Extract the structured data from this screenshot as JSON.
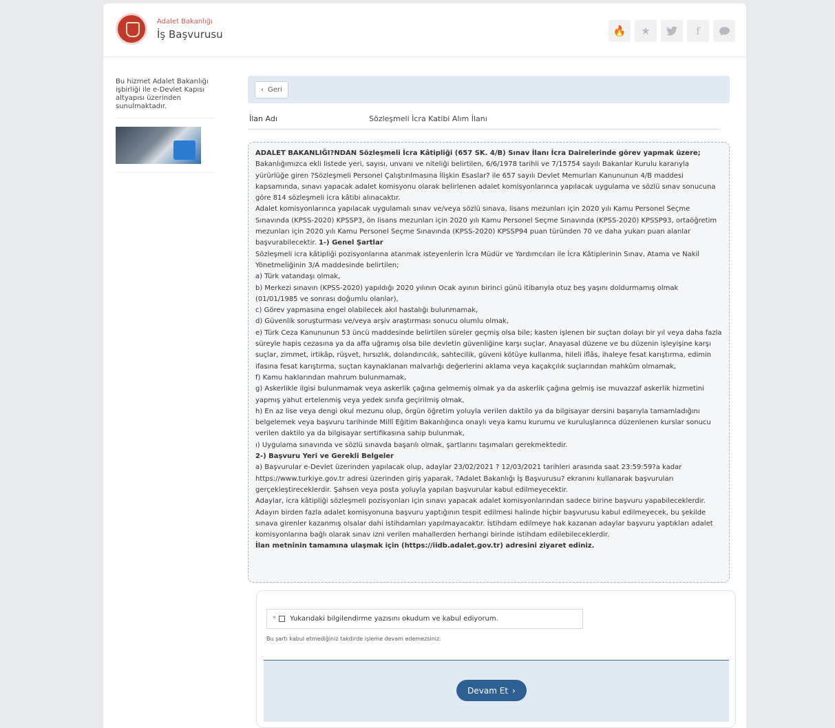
{
  "header": {
    "subtitle": "Adalet Bakanlığı",
    "title": "İş Başvurusu",
    "icons": [
      "fire-icon",
      "star-icon",
      "twitter-icon",
      "facebook-icon",
      "chat-icon"
    ]
  },
  "sidebar": {
    "info": "Bu hizmet Adalet Bakanlığı işbirliği ile e-Devlet Kapısı altyapısı üzerinden sunulmaktadır."
  },
  "nav": {
    "back_label": "Geri"
  },
  "ilan": {
    "label": "İlan Adı",
    "value": "Sözleşmeli İcra Katibi Alım İlanı"
  },
  "notice": {
    "heading": "ADALET BAKANLIĞI?NDAN Sözleşmeli İcra Kâtipliği (657 SK. 4/B) Sınav İlanı İcra Dairelerinde görev yapmak üzere;",
    "p1": "Bakanlığımızca ekli listede yeri, sayısı, unvanı ve niteliği belirtilen, 6/6/1978 tarihli ve 7/15754 sayılı Bakanlar Kurulu kararıyla yürürlüğe giren ?Sözleşmeli Personel Çalıştırılmasına İlişkin Esaslar? ile 657 sayılı Devlet Memurları Kanununun 4/B maddesi kapsamında, sınavı yapacak adalet komisyonu olarak belirlenen adalet komisyonlarınca yapılacak uygulama ve sözlü sınav sonucuna göre 814 sözleşmeli icra kâtibi alınacaktır.",
    "p2": "Adalet komisyonlarınca yapılacak uygulamalı sınav ve/veya sözlü sınava, lisans mezunları için 2020 yılı Kamu Personel Seçme Sınavında (KPSS-2020) KPSSP3, ön lisans mezunları için 2020 yılı Kamu Personel Seçme Sınavında (KPSS-2020) KPSSP93, ortaöğretim mezunları için 2020 yılı Kamu Personel Seçme Sınavında (KPSS-2020) KPSSP94 puan türünden 70 ve daha yukarı puan alanlar başvurabilecektir.",
    "genel_sartlar": "1-) Genel Şartlar",
    "p3": "Sözleşmeli icra kâtipliği pozisyonlarına atanmak isteyenlerin İcra Müdür ve Yardımcıları ile İcra Kâtiplerinin Sınav, Atama ve Nakil Yönetmeliğinin 3/A maddesinde belirtilen;",
    "a": "a) Türk vatandaşı olmak,",
    "b": "b) Merkezi sınavın (KPSS-2020) yapıldığı 2020 yılının Ocak ayının birinci günü itibarıyla otuz beş yaşını doldurmamış olmak (01/01/1985 ve sonrası doğumlu olanlar),",
    "c": "c) Görev yapmasına engel olabilecek akıl hastalığı bulunmamak,",
    "d": "d) Güvenlik soruşturması ve/veya arşiv araştırması sonucu olumlu olmak,",
    "e": "e) Türk Ceza Kanununun 53 üncü maddesinde belirtilen süreler geçmiş olsa bile; kasten işlenen bir suçtan dolayı bir yıl veya daha fazla süreyle hapis cezasına ya da affa uğramış olsa bile devletin güvenliğine karşı suçlar, Anayasal düzene ve bu düzenin işleyişine karşı suçlar, zimmet, irtikâp, rüşvet, hırsızlık, dolandırıcılık, sahtecilik, güveni kötüye kullanma, hileli iflâs, ihaleye fesat karıştırma, edimin ifasına fesat karıştırma, suçtan kaynaklanan malvarlığı değerlerini aklama veya kaçakçılık suçlarından mahkûm olmamak,",
    "f": "f) Kamu haklarından mahrum bulunmamak,",
    "g": "g) Askerlikle ilgisi bulunmamak veya askerlik çağına gelmemiş olmak ya da askerlik çağına gelmiş ise muvazzaf askerlik hizmetini yapmış yahut ertelenmiş veya yedek sınıfa geçirilmiş olmak,",
    "h": "h) En az lise veya dengi okul mezunu olup, örgün öğretim yoluyla verilen daktilo ya da bilgisayar dersini başarıyla tamamladığını belgelemek veya başvuru tarihinde Millî Eğitim Bakanlığınca onaylı veya kamu kurumu ve kuruluşlarınca düzenlenen kurslar sonucu verilen daktilo ya da bilgisayar sertifikasına sahip bulunmak,",
    "i": "ı) Uygulama sınavında ve sözlü sınavda başarılı olmak, şartlarını taşımaları gerekmektedir.",
    "basvuru_heading": "2-) Başvuru Yeri ve Gerekli Belgeler",
    "p4": "a) Başvurular e-Devlet üzerinden yapılacak olup, adaylar 23/02/2021 ? 12/03/2021 tarihleri arasında saat 23:59:59?a kadar https://www.turkiye.gov.tr adresi üzerinden giriş yaparak, ?Adalet Bakanlığı İş Başvurusu? ekranını kullanarak başvuruları gerçekleştireceklerdir. Şahsen veya posta yoluyla yapılan başvurular kabul edilmeyecektir.",
    "p5": "Adaylar, icra kâtipliği sözleşmeli pozisyonları için sınavı yapacak adalet komisyonlarından sadece birine başvuru yapabileceklerdir. Adayın birden fazla adalet komisyonuna başvuru yaptığının tespit edilmesi halinde hiçbir başvurusu kabul edilmeyecek, bu şekilde sınava girenler kazanmış olsalar dahi istihdamları yapılmayacaktır. İstihdam edilmeye hak kazanan adaylar başvuru yaptıkları adalet komisyonlarına bağlı olarak sınav izni verilen mahallerden herhangi birinde istihdam edilebileceklerdir.",
    "footer": "İlan metninin tamamına ulaşmak için (https://iidb.adalet.gov.tr) adresini ziyaret ediniz."
  },
  "agreement": {
    "required_mark": "*",
    "checkbox_label": "Yukarıdaki bilgilendirme yazısını okudum ve kabul ediyorum.",
    "checked": false,
    "warning": "Bu şartı kabul etmediğiniz takdirde işleme devam edemezsiniz."
  },
  "actions": {
    "continue_label": "Devam Et"
  },
  "colors": {
    "primary": "#2e5f92",
    "panel": "#e1e9f2",
    "brand_red": "#c0392b"
  }
}
